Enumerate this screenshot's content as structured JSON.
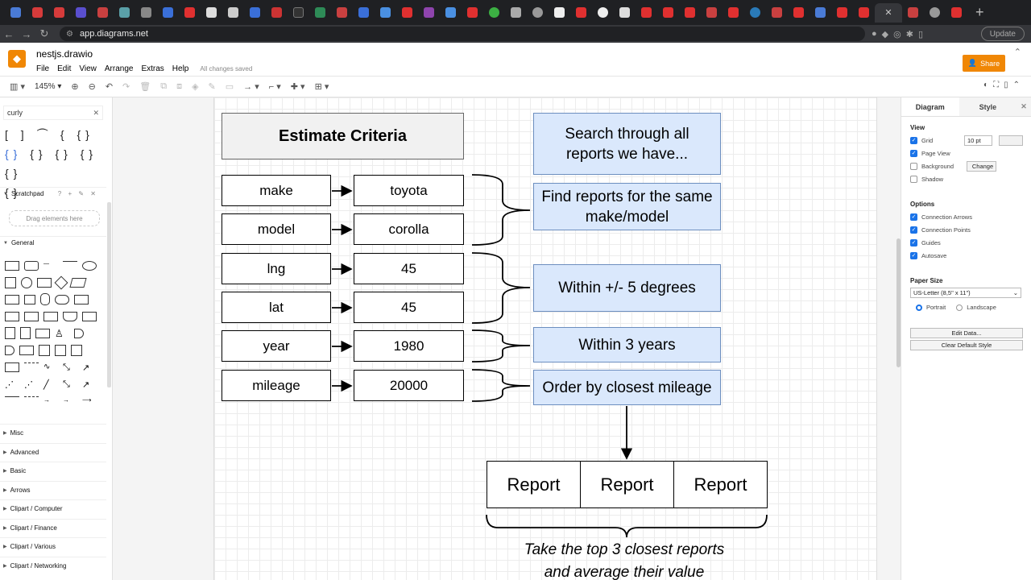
{
  "browser": {
    "url": "app.diagrams.net",
    "update_label": "Update"
  },
  "app": {
    "filename": "nestjs.drawio",
    "menus": [
      "File",
      "Edit",
      "View",
      "Arrange",
      "Extras",
      "Help"
    ],
    "saved_status": "All changes saved",
    "share_label": "Share"
  },
  "toolbar": {
    "zoom": "145%"
  },
  "sidebar": {
    "search_value": "curly",
    "scratchpad_label": "Scratchpad",
    "drag_hint": "Drag elements here",
    "general_label": "General",
    "categories": [
      "Misc",
      "Advanced",
      "Basic",
      "Arrows",
      "Clipart / Computer",
      "Clipart / Finance",
      "Clipart / Various",
      "Clipart / Networking"
    ]
  },
  "diagram": {
    "title": "Estimate Criteria",
    "criteria": [
      {
        "key": "make",
        "value": "toyota"
      },
      {
        "key": "model",
        "value": "corolla"
      },
      {
        "key": "lng",
        "value": "45"
      },
      {
        "key": "lat",
        "value": "45"
      },
      {
        "key": "year",
        "value": "1980"
      },
      {
        "key": "mileage",
        "value": "20000"
      }
    ],
    "steps": [
      "Search through all reports we have...",
      "Find reports for the same make/model",
      "Within +/- 5 degrees",
      "Within 3 years",
      "Order by closest mileage"
    ],
    "reports": [
      "Report",
      "Report",
      "Report"
    ],
    "caption_line1": "Take the top 3 closest reports",
    "caption_line2": "and average their value"
  },
  "format_panel": {
    "tab_diagram": "Diagram",
    "tab_style": "Style",
    "view_label": "View",
    "grid_label": "Grid",
    "grid_size": "10 pt",
    "page_view_label": "Page View",
    "background_label": "Background",
    "change_label": "Change",
    "shadow_label": "Shadow",
    "options_label": "Options",
    "connection_arrows_label": "Connection Arrows",
    "connection_points_label": "Connection Points",
    "guides_label": "Guides",
    "autosave_label": "Autosave",
    "paper_size_label": "Paper Size",
    "paper_size_value": "US-Letter (8,5\" x 11\")",
    "portrait_label": "Portrait",
    "landscape_label": "Landscape",
    "edit_data_label": "Edit Data...",
    "clear_style_label": "Clear Default Style"
  }
}
